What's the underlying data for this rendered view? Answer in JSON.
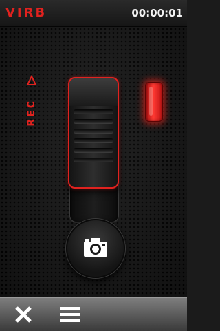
{
  "header": {
    "brand": "VIRB",
    "timer": "00:00:01"
  },
  "recorder": {
    "rec_label": "REC",
    "led_state": "recording",
    "accent_color": "#e0221f"
  },
  "icons": {
    "rec_arrow": "triangle-up-outline-icon",
    "camera": "camera-icon",
    "close": "close-icon",
    "menu": "menu-icon"
  }
}
